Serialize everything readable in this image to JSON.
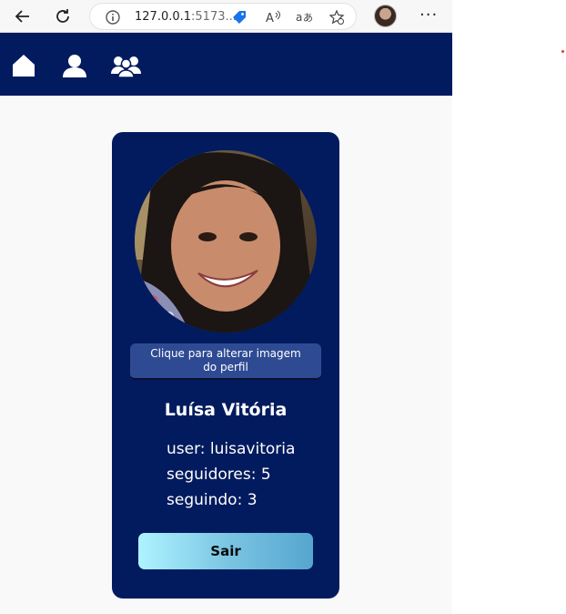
{
  "browser": {
    "url_host": "127.0.0.1",
    "url_rest": ":5173..."
  },
  "profile": {
    "change_image_label": "Clique para alterar imagem do perfil",
    "name": "Luísa Vitória",
    "user_line": "user: luisavitoria",
    "followers_line": "seguidores: 5",
    "following_line": "seguindo: 3",
    "logout_label": "Sair"
  },
  "colors": {
    "nav_bg": "#021b5e",
    "card_bg": "#021b5e",
    "change_btn_bg": "#2e4a93",
    "logout_gradient_start": "#aef3ff",
    "logout_gradient_end": "#55a5cf"
  },
  "icons": [
    "back-arrow-icon",
    "refresh-icon",
    "info-icon",
    "tag-icon",
    "read-aloud-icon",
    "translate-icon",
    "favorite-icon",
    "profile-avatar",
    "more-icon",
    "home-icon",
    "user-icon",
    "users-icon"
  ]
}
